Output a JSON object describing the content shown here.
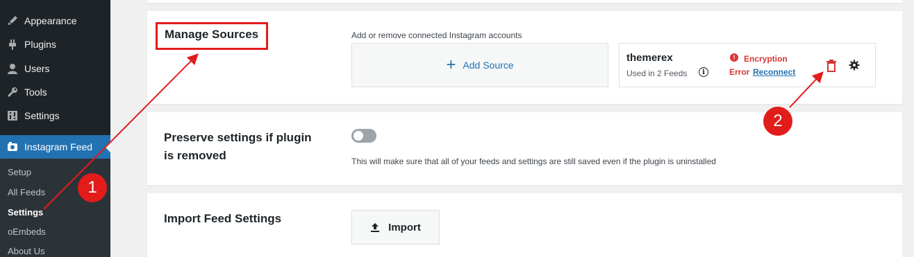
{
  "sidebar": {
    "items": [
      {
        "label": "Appearance",
        "icon": "paintbrush-icon"
      },
      {
        "label": "Plugins",
        "icon": "plugin-icon"
      },
      {
        "label": "Users",
        "icon": "user-icon"
      },
      {
        "label": "Tools",
        "icon": "wrench-icon"
      },
      {
        "label": "Settings",
        "icon": "settings-sliders-icon"
      },
      {
        "label": "Instagram Feed",
        "icon": "camera-icon"
      }
    ],
    "submenu": [
      {
        "label": "Setup"
      },
      {
        "label": "All Feeds"
      },
      {
        "label": "Settings"
      },
      {
        "label": "oEmbeds"
      },
      {
        "label": "About Us"
      }
    ]
  },
  "sources": {
    "title": "Manage Sources",
    "hint": "Add or remove connected Instagram accounts",
    "add_label": "Add Source",
    "account": {
      "name": "themerex",
      "used": "Used in 2 Feeds",
      "error_line1": "Encryption",
      "error_line2": "Error",
      "reconnect": "Reconnect"
    }
  },
  "preserve": {
    "title_line1": "Preserve settings if plugin",
    "title_line2": "is removed",
    "hint": "This will make sure that all of your feeds and settings are still saved even if the plugin is uninstalled",
    "enabled": false
  },
  "import": {
    "title": "Import Feed Settings",
    "button": "Import"
  },
  "annotations": [
    "1",
    "2"
  ],
  "colors": {
    "sidebar_bg": "#1d2327",
    "active_bg": "#2271b1",
    "link": "#2271b1",
    "error": "#d63638",
    "annotation_red": "#e21b1b"
  }
}
